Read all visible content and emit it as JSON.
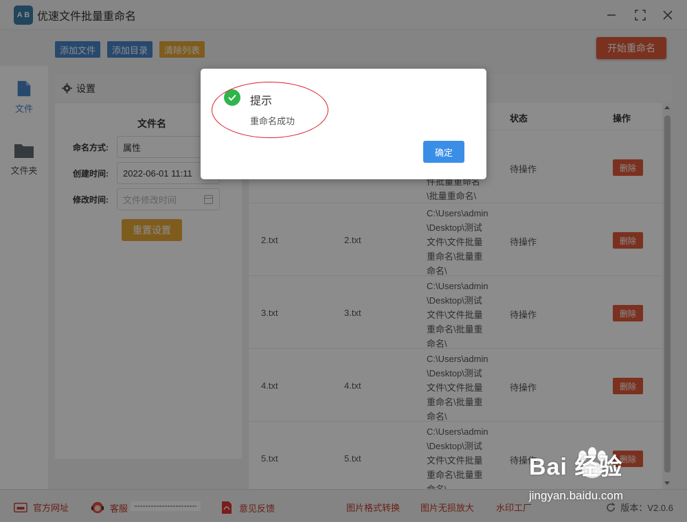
{
  "window": {
    "logo_text": "A B",
    "title": "优速文件批量重命名"
  },
  "toolbar": {
    "add_file": "添加文件",
    "add_dir": "添加目录",
    "clear_list": "清除列表",
    "start_rename": "开始重命名"
  },
  "colors": {
    "blue": "#4a86c8",
    "orange": "#e5a838",
    "red": "#e05a3a",
    "ok_blue": "#3a8ee6",
    "success_green": "#2fb54a"
  },
  "nav": {
    "file": "文件",
    "folder": "文件夹"
  },
  "settings": {
    "header": "设置",
    "section_title": "文件名",
    "naming_label": "命名方式:",
    "naming_value": "属性",
    "created_label": "创建时间:",
    "created_value": "2022-06-01 11:11",
    "modified_label": "修改时间:",
    "modified_placeholder": "文件修改时间",
    "reset_button": "重置设置"
  },
  "table": {
    "columns": {
      "status": "状态",
      "action": "操作"
    },
    "rows": [
      {
        "name": "",
        "new_name": "",
        "path": "件批量重命名\\批量重命名\\",
        "status": "待操作",
        "action": "删除"
      },
      {
        "name": "2.txt",
        "new_name": "2.txt",
        "path": "C:\\Users\\admin\\Desktop\\测试文件\\文件批量重命名\\批量重命名\\",
        "status": "待操作",
        "action": "删除"
      },
      {
        "name": "3.txt",
        "new_name": "3.txt",
        "path": "C:\\Users\\admin\\Desktop\\测试文件\\文件批量重命名\\批量重命名\\",
        "status": "待操作",
        "action": "删除"
      },
      {
        "name": "4.txt",
        "new_name": "4.txt",
        "path": "C:\\Users\\admin\\Desktop\\测试文件\\文件批量重命名\\批量重命名\\",
        "status": "待操作",
        "action": "删除"
      },
      {
        "name": "5.txt",
        "new_name": "5.txt",
        "path": "C:\\Users\\admin\\Desktop\\测试文件\\文件批量重命名\\批量重命名\\",
        "status": "待操作",
        "action": "删除"
      }
    ]
  },
  "footer": {
    "website": "官方网址",
    "service": "客服",
    "feedback": "意见反馈",
    "img_convert": "图片格式转换",
    "img_upscale": "图片无损放大",
    "watermark_tool": "水印工厂",
    "version": "版本：V2.0.6"
  },
  "dialog": {
    "title": "提示",
    "message": "重命名成功",
    "ok": "确定"
  },
  "overlay_watermark": {
    "brand": "Bai 经验",
    "url": "jingyan.baidu.com"
  }
}
